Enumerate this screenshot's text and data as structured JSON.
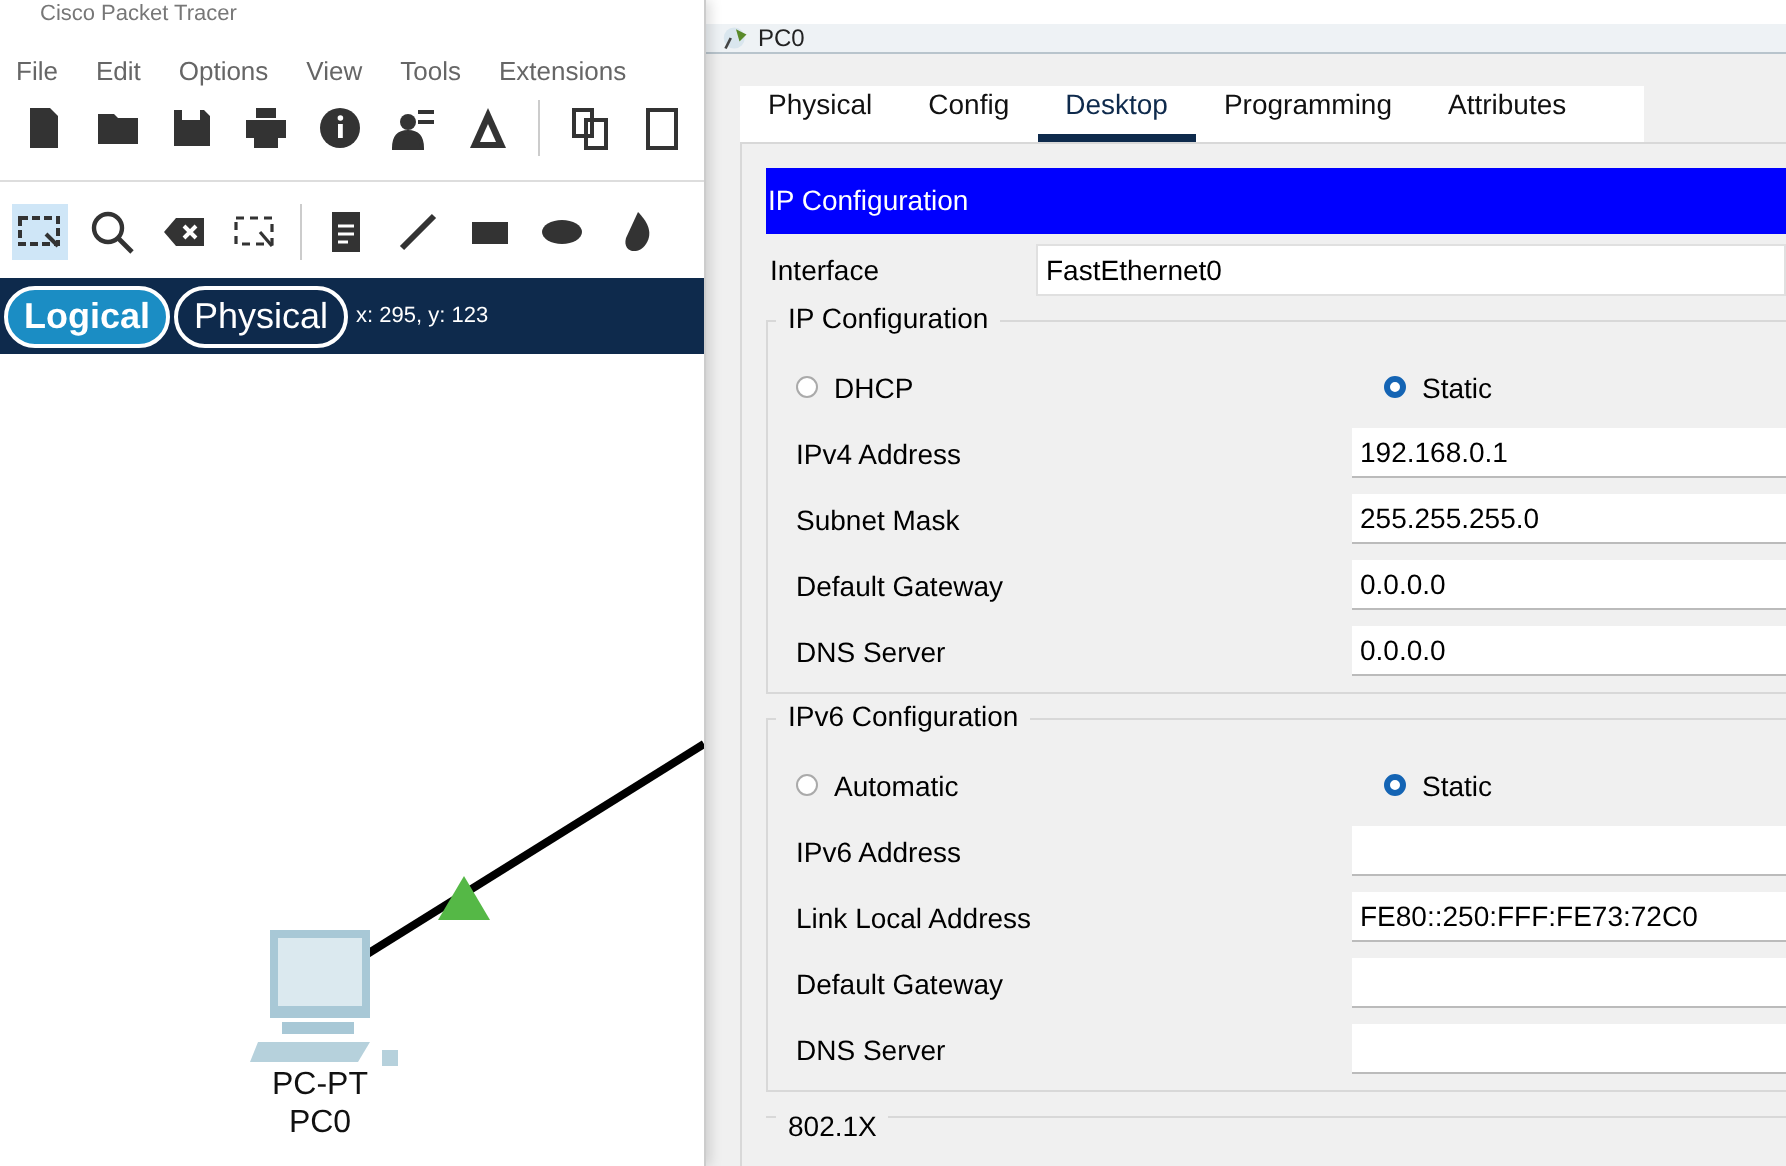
{
  "app": {
    "title": "Cisco Packet Tracer",
    "menu": [
      "File",
      "Edit",
      "Options",
      "View",
      "Tools",
      "Extensions"
    ],
    "toolbar": [
      {
        "kind": "new"
      },
      {
        "kind": "folder"
      },
      {
        "kind": "save"
      },
      {
        "kind": "print"
      },
      {
        "kind": "info"
      },
      {
        "kind": "user"
      },
      {
        "kind": "wizard"
      },
      {
        "kind": "sep"
      },
      {
        "kind": "copy"
      },
      {
        "kind": "paste"
      }
    ],
    "tool_groups": [
      [
        {
          "kind": "select",
          "selected": true
        },
        {
          "kind": "search",
          "selected": false
        },
        {
          "kind": "delete",
          "selected": false
        },
        {
          "kind": "resize",
          "selected": false
        }
      ],
      [
        {
          "kind": "note",
          "selected": false
        },
        {
          "kind": "line",
          "selected": false
        },
        {
          "kind": "rect",
          "selected": false
        },
        {
          "kind": "ellipse",
          "selected": false
        },
        {
          "kind": "freeform",
          "selected": false
        }
      ]
    ],
    "views": [
      {
        "label": "Logical",
        "selected": true
      },
      {
        "label": "Physical",
        "selected": false
      }
    ],
    "coordinates": "x: 295, y: 123",
    "device": {
      "model": "PC-PT",
      "name": "PC0"
    }
  },
  "dialog": {
    "title": "PC0",
    "tabs": [
      {
        "label": "Physical",
        "selected": false
      },
      {
        "label": "Config",
        "selected": false
      },
      {
        "label": "Desktop",
        "selected": true
      },
      {
        "label": "Programming",
        "selected": false
      },
      {
        "label": "Attributes",
        "selected": false
      }
    ],
    "header": "IP Configuration",
    "interface": {
      "label": "Interface",
      "value": "FastEthernet0"
    },
    "sections": [
      {
        "legend": "IP Configuration",
        "modes": [
          {
            "label": "DHCP",
            "selected": false
          },
          {
            "label": "Static",
            "selected": true
          }
        ],
        "fields": [
          {
            "label": "IPv4 Address",
            "value": "192.168.0.1"
          },
          {
            "label": "Subnet Mask",
            "value": "255.255.255.0"
          },
          {
            "label": "Default Gateway",
            "value": "0.0.0.0"
          },
          {
            "label": "DNS Server",
            "value": "0.0.0.0"
          }
        ]
      },
      {
        "legend": "IPv6 Configuration",
        "modes": [
          {
            "label": "Automatic",
            "selected": false
          },
          {
            "label": "Static",
            "selected": true
          }
        ],
        "fields": [
          {
            "label": "IPv6 Address"
          },
          {
            "label": "Link Local Address",
            "value": "FE80::250:FFF:FE73:72C0"
          },
          {
            "label": "Default Gateway"
          },
          {
            "label": "DNS Server"
          }
        ]
      },
      {
        "legend": "802.1X"
      }
    ]
  }
}
